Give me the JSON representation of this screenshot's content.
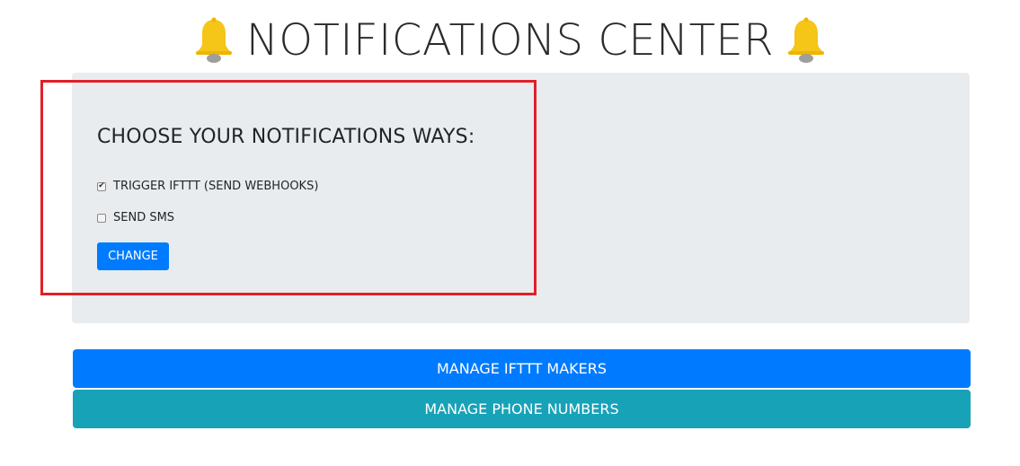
{
  "header": {
    "title": "NOTIFICATIONS CENTER",
    "left_icon": "bell-icon",
    "right_icon": "bell-icon"
  },
  "settings_panel": {
    "heading": "CHOOSE YOUR NOTIFICATIONS WAYS:",
    "options": [
      {
        "label": "TRIGGER IFTTT (SEND WEBHOOKS)",
        "checked": true
      },
      {
        "label": "SEND SMS",
        "checked": false
      }
    ],
    "change_label": "CHANGE"
  },
  "actions": {
    "manage_makers_label": "MANAGE IFTTT MAKERS",
    "manage_phones_label": "MANAGE PHONE NUMBERS"
  },
  "colors": {
    "primary": "#007bff",
    "info": "#17a2b8",
    "panel_bg": "#e9ecef",
    "highlight": "#e0202a",
    "bell": "#f5c518"
  }
}
